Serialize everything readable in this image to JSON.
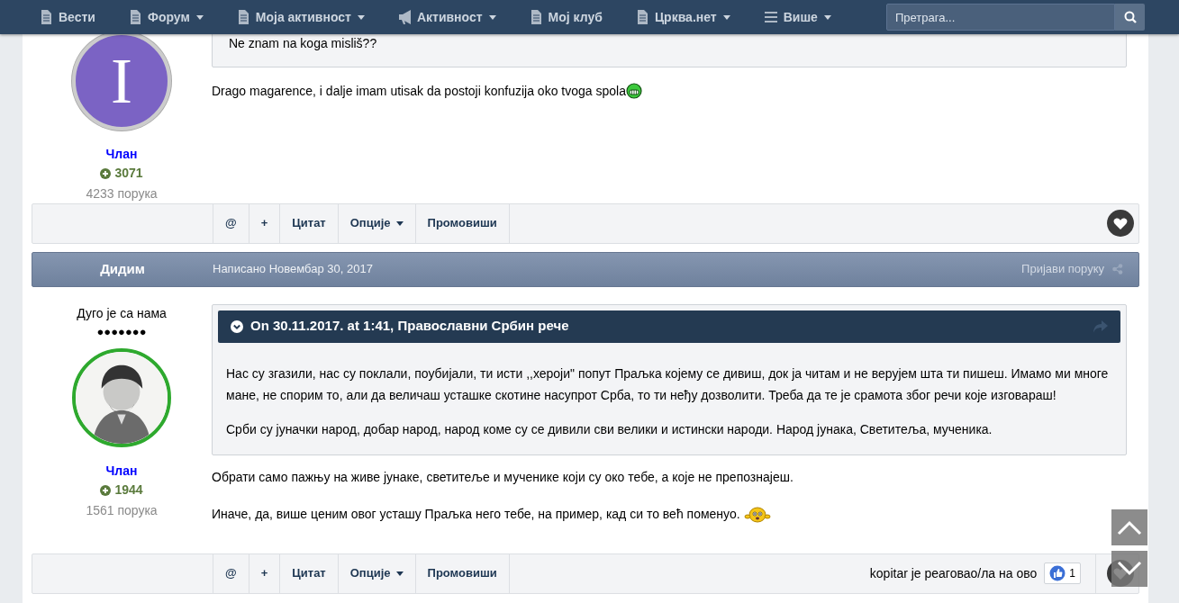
{
  "nav": {
    "items": [
      {
        "label": "Вести",
        "kind": "document",
        "dropdown": false
      },
      {
        "label": "Форум",
        "kind": "document",
        "dropdown": true
      },
      {
        "label": "Моја активност",
        "kind": "document",
        "dropdown": true
      },
      {
        "label": "Активност",
        "kind": "megaphone",
        "dropdown": true
      },
      {
        "label": "Мој клуб",
        "kind": "document",
        "dropdown": false
      },
      {
        "label": "Црква.нет",
        "kind": "document",
        "dropdown": true
      },
      {
        "label": "Више",
        "kind": "menu",
        "dropdown": true
      }
    ],
    "search": {
      "placeholder": "Претрага..."
    }
  },
  "posts": [
    {
      "avatar": {
        "kind": "letter",
        "letter": "I"
      },
      "group": "Члан",
      "reputation": "3071",
      "post_count": "4233 порука",
      "quote": {
        "paragraphs": [
          "Ne znam na koga misliš??"
        ]
      },
      "body": [
        {
          "text": "Drago magarence, i dalje imam utisak da postoji konfuzija oko tvoga spola",
          "kind": "grin"
        }
      ],
      "actions": [
        {
          "label": "@",
          "dropdown": false
        },
        {
          "label": "+",
          "dropdown": false
        },
        {
          "label": "Цитат",
          "dropdown": false
        },
        {
          "label": "Опције",
          "dropdown": true
        },
        {
          "label": "Промовиши",
          "dropdown": false
        }
      ]
    },
    {
      "header": {
        "author": "Дидим",
        "date": "Написано Новембар 30, 2017",
        "report": "Пријави поруку"
      },
      "rank": "Дуго је са нама",
      "pips": "●●●●●●●",
      "group": "Члан",
      "reputation": "1944",
      "post_count": "1561 порука",
      "quote": {
        "citation": "On 30.11.2017. at 1:41, Православни Србин рече",
        "paragraphs": [
          "Нас су згазили, нас су поклали, поубијали, ти исти ,,хероји\" попут Праљка којему се дивиш, док ја читам и не верујем шта ти пишеш. Имамо ми многе мане, не спорим то, али да величаш усташке скотине насупрот Срба, то ти неђу дозволити. Треба да те је срамота због речи које изговараш!",
          "Срби су јуначки народ, добар народ, народ коме су се дивили сви велики и истински народи. Народ јунака, Светитеља, мученика."
        ]
      },
      "body": [
        {
          "text": "Обрати само пажњу на живе јунаке, светитеље и мученике који су око тебе, а које не препознајеш.",
          "kind": "plain"
        },
        {
          "text": "Иначе, да, више ценим овог усташу Праљка него тебе, на пример, кад си то већ поменуо.",
          "kind": "smiley"
        }
      ],
      "actions": [
        {
          "label": "@",
          "dropdown": false
        },
        {
          "label": "+",
          "dropdown": false
        },
        {
          "label": "Цитат",
          "dropdown": false
        },
        {
          "label": "Опције",
          "dropdown": true
        },
        {
          "label": "Промовиши",
          "dropdown": false
        }
      ],
      "reaction": {
        "text": "kopitar je реаговао/ла на ово",
        "count": "1"
      }
    }
  ]
}
